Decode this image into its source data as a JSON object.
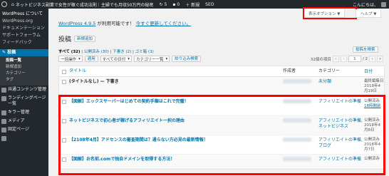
{
  "admin_bar": {
    "site_name": "ネットビジネス副業で女性が稼ぐ成功法則｜主婦でも月収50万円の秘密",
    "updates_count": "5",
    "comments_count": "0",
    "new_label": "＋ 新規",
    "seo_label": "SEO",
    "greeting": "こんにちは、"
  },
  "sidebar": {
    "top_items": [
      "WordPress について",
      "WordPress.org",
      "ドキュメンテーション",
      "サポートフォーラム",
      "フィードバック"
    ],
    "posts_label": "投稿",
    "sub_items": [
      {
        "label": "投稿一覧",
        "current": true
      },
      {
        "label": "新規追加",
        "current": false
      },
      {
        "label": "カテゴリー",
        "current": false
      },
      {
        "label": "タグ",
        "current": false
      }
    ],
    "menu_items": [
      {
        "label": "共通コンテンツ管理",
        "icon": "common-content-icon"
      },
      {
        "label": "ランディングページ一覧",
        "icon": "landing-page-icon"
      },
      {
        "label": "キラー管理",
        "icon": "killer-icon"
      },
      {
        "label": "メディア",
        "icon": "media-icon"
      },
      {
        "label": "固定ページ",
        "icon": "page-icon"
      },
      {
        "label": "",
        "icon": "comment-icon"
      }
    ]
  },
  "top_tabs": {
    "screen_options": "表示オプション ▼",
    "help": "ヘルプ ▼"
  },
  "notice": {
    "version_text": "WordPress 4.9.5",
    "text_mid": " が利用可能です！ ",
    "link_text": "今すぐ更新してください。"
  },
  "page": {
    "title": "投稿",
    "add_new": "新規追加"
  },
  "filters": {
    "all": "すべて (32)",
    "published": "公開済み (30)",
    "draft": "下書き (2)",
    "trash": "ゴミ箱 (3)",
    "sep": " | "
  },
  "search": {
    "button": "投稿を検索"
  },
  "tablenav": {
    "bulk_action": "一括操作",
    "apply": "適用",
    "all_dates": "すべての日付",
    "category_all": "カテゴリー一覧",
    "filter_button": "絞り込み検索",
    "items_count": "32個の項目",
    "first": "«",
    "prev": "‹",
    "current_page": "1",
    "of_pages": "/ 2",
    "next": "›",
    "last": "»"
  },
  "table": {
    "headers": {
      "title": "タイトル",
      "author": "作成者",
      "category": "カテゴリー",
      "date": "日付"
    },
    "rows": [
      {
        "title": "(タイトルなし) — 下書き",
        "category": "未分類",
        "date_status": "最終編集日",
        "date": "2018年4月19日",
        "link_date": false,
        "dark_title": true
      },
      {
        "title": "【図解】エックスサーバーはじめての契約手順はこれで完璧！",
        "category": "アフィリエイトの準備",
        "date_status": "公開済み",
        "date": "18時間前",
        "link_date": true,
        "dark_title": false
      },
      {
        "title": "ネットビジネスで初心者が稼げるアフィリエイト一択の理由",
        "category": "アフィリエイトの準備, ネットビジネス",
        "date_status": "公開済み",
        "date": "2018年4月8日",
        "link_date": false,
        "dark_title": false
      },
      {
        "title": "【2108年4月】アドセンスの審査期間は？通らない方必見の最新情報！",
        "category": "アフィリエイトの準備, ブログ",
        "date_status": "公開済み",
        "date": "2018年4月7日",
        "link_date": false,
        "dark_title": false
      },
      {
        "title": "【図解】お名前.comで独自ドメインを取得する方法！",
        "category": "アフィリエイトの準備",
        "date_status": "公開済み",
        "date": "",
        "link_date": false,
        "dark_title": false
      }
    ]
  },
  "colors": {
    "admin_dark": "#23282d",
    "wp_blue": "#0073aa",
    "highlight_red": "#ff0000"
  }
}
